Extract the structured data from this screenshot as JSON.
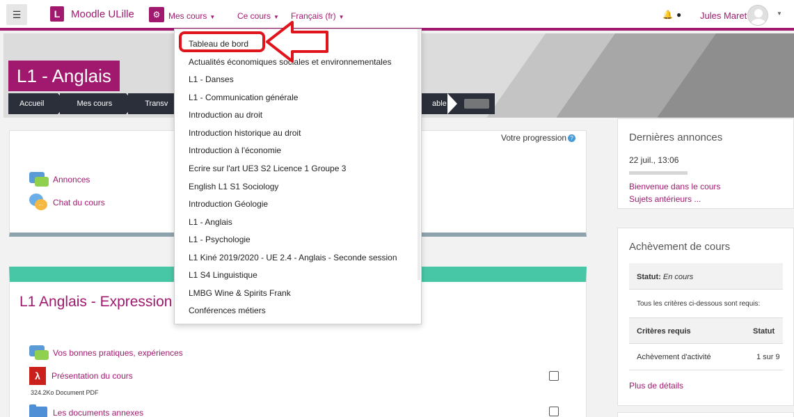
{
  "navbar": {
    "hamburger_icon": "hamburger-menu-icon",
    "logo_letter": "L",
    "site_name": "Moodle ULille",
    "cog_icon": "cogs-icon",
    "menus": [
      "Mes cours",
      "Ce cours",
      "Français (fr)"
    ],
    "user_name": "Jules Maret",
    "colors": {
      "brand": "#a1196f"
    }
  },
  "header": {
    "course_title": "L1 - Anglais",
    "breadcrumb": [
      "Accueil",
      "Mes cours",
      "Transv"
    ],
    "breadcrumb_tail": "able"
  },
  "dropdown": {
    "items": [
      "Tableau de bord",
      "Actualités économiques sociales et environnementales",
      "L1 - Danses",
      "L1 - Communication générale",
      "Introduction au droit",
      "Introduction historique au droit",
      "Introduction à l'économie",
      "Ecrire sur l'art UE3 S2 Licence 1 Groupe 3",
      "English L1 S1 Sociology",
      "Introduction Géologie",
      "L1 - Anglais",
      "L1 - Psychologie",
      "L1 Kiné 2019/2020 - UE 2.4 - Anglais - Seconde session",
      "L1 S4 Linguistique",
      "LMBG Wine & Spirits Frank",
      "Conférences métiers"
    ],
    "highlight_color": "#e0141d"
  },
  "main": {
    "progress_label": "Votre progression",
    "activities": [
      "Annonces",
      "Chat du cours"
    ],
    "section_title": "L1 Anglais - Expression é",
    "section_items": [
      {
        "label": "Vos bonnes pratiques, expériences"
      },
      {
        "label": "Présentation du cours",
        "meta": "324.2Ko Document PDF"
      },
      {
        "label": "Les documents annexes"
      }
    ]
  },
  "sidebar": {
    "announcements": {
      "title": "Dernières annonces",
      "date": "22 juil., 13:06",
      "post": "Bienvenue dans le cours",
      "older": "Sujets antérieurs ..."
    },
    "completion": {
      "title": "Achèvement de cours",
      "status_label": "Statut:",
      "status_value": "En cours",
      "all_criteria": "Tous les critères ci-dessous sont requis:",
      "col_criteria": "Critères requis",
      "col_status": "Statut",
      "row_criteria": "Achèvement d'activité",
      "row_status": "1 sur 9",
      "more": "Plus de détails"
    }
  }
}
